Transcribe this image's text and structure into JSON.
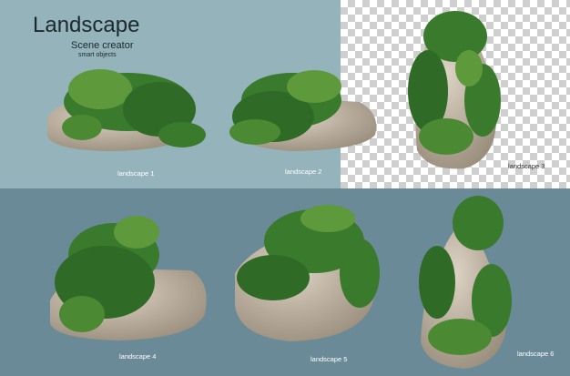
{
  "header": {
    "title": "Landscape",
    "subtitle": "Scene creator",
    "tagline": "smart objects"
  },
  "items": [
    {
      "label": "landscape 1"
    },
    {
      "label": "landscape 2"
    },
    {
      "label": "landscape 3"
    },
    {
      "label": "landscape 4"
    },
    {
      "label": "landscape 5"
    },
    {
      "label": "landscape 6"
    }
  ],
  "colors": {
    "top_panel": "#95b3ba",
    "bottom_panel": "#6a8a97",
    "rock": "#c9bca9",
    "leaf_dark": "#2f6a26",
    "leaf_light": "#5e9a3b"
  }
}
